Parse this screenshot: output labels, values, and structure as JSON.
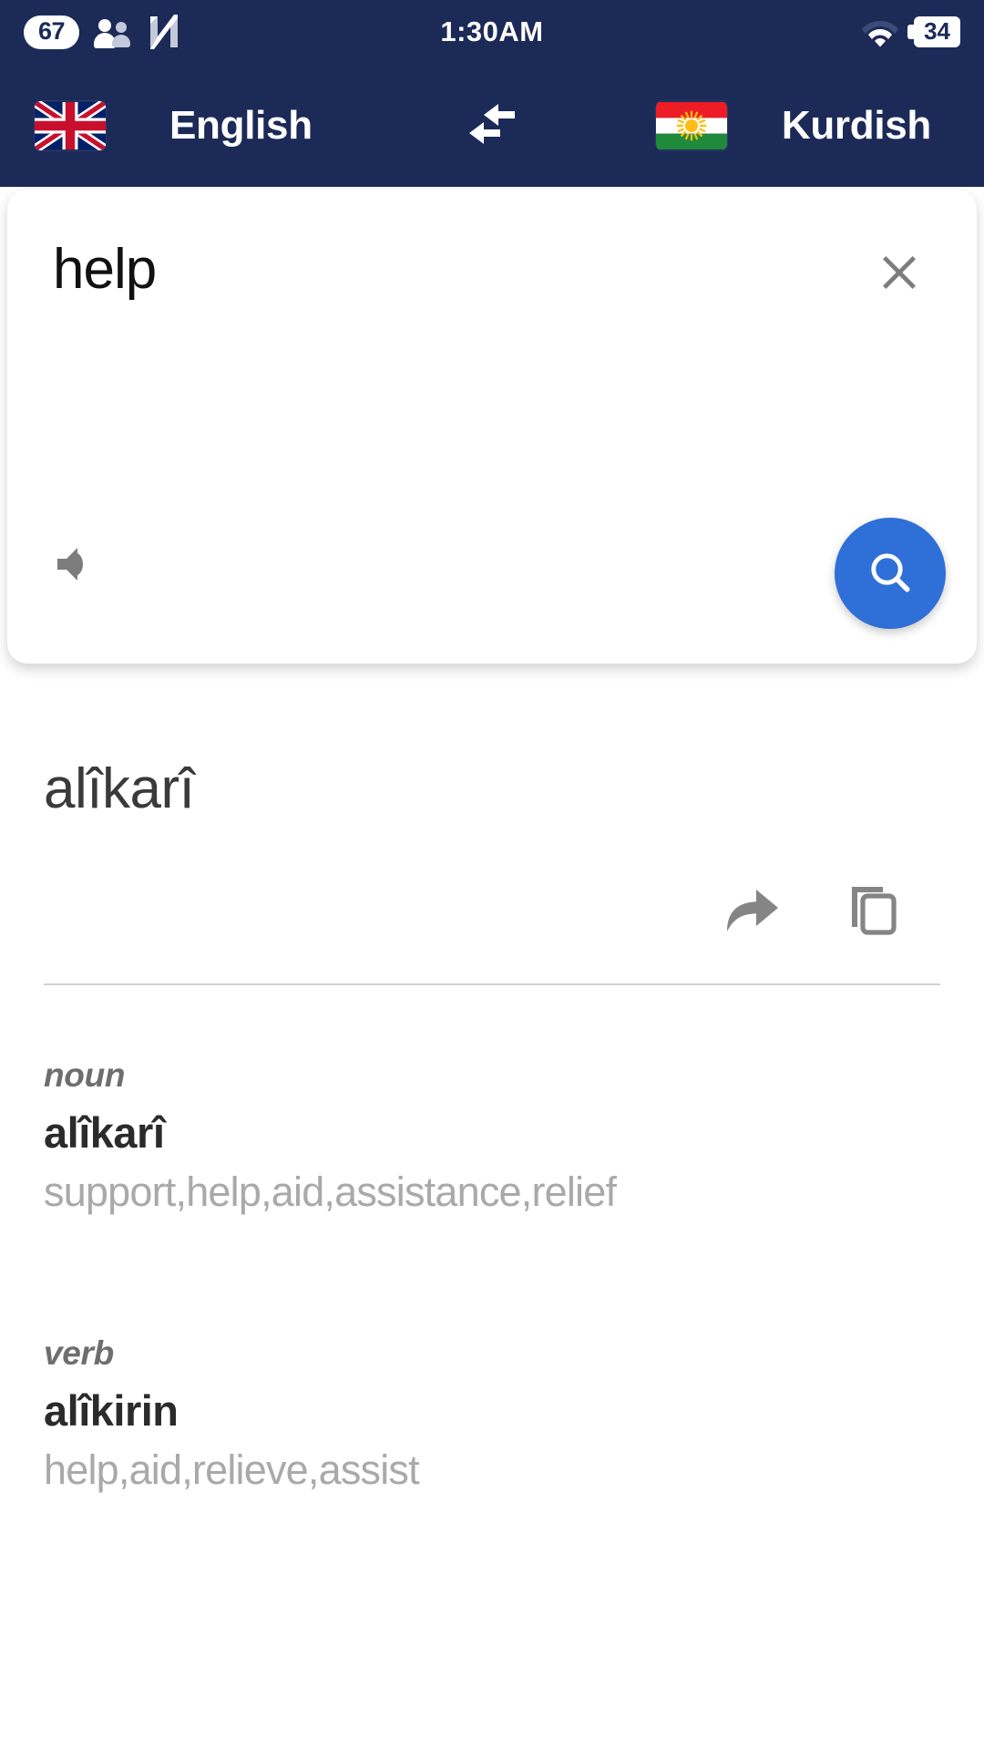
{
  "status_bar": {
    "notification_count": "67",
    "time": "1:30AM",
    "battery_level": "34",
    "icons": {
      "people": "people-icon",
      "app_n": "n-app-icon",
      "wifi": "wifi-icon",
      "battery": "battery-icon"
    }
  },
  "language_bar": {
    "source": {
      "flag": "uk-flag",
      "name": "English"
    },
    "target": {
      "flag": "kurdistan-flag",
      "name": "Kurdish"
    },
    "swap_icon": "swap-arrows-icon"
  },
  "search_card": {
    "query": "help",
    "placeholder": "",
    "clear_icon": "close-x-icon",
    "speaker_icon": "speaker-icon",
    "search_icon": "search-icon",
    "accent_color": "#2f6fd8"
  },
  "result": {
    "translation": "alîkarî",
    "share_icon": "share-arrow-icon",
    "copy_icon": "copy-icon"
  },
  "definitions": [
    {
      "part_of_speech": "noun",
      "term": "alîkarî",
      "synonyms": "support,help,aid,assistance,relief"
    },
    {
      "part_of_speech": "verb",
      "term": "alîkirin",
      "synonyms": "help,aid,relieve,assist"
    }
  ],
  "colors": {
    "header_bg": "#1b2a57",
    "accent": "#2f6fd8",
    "muted_text": "#a9a9a9",
    "divider": "#d2d2d2"
  }
}
